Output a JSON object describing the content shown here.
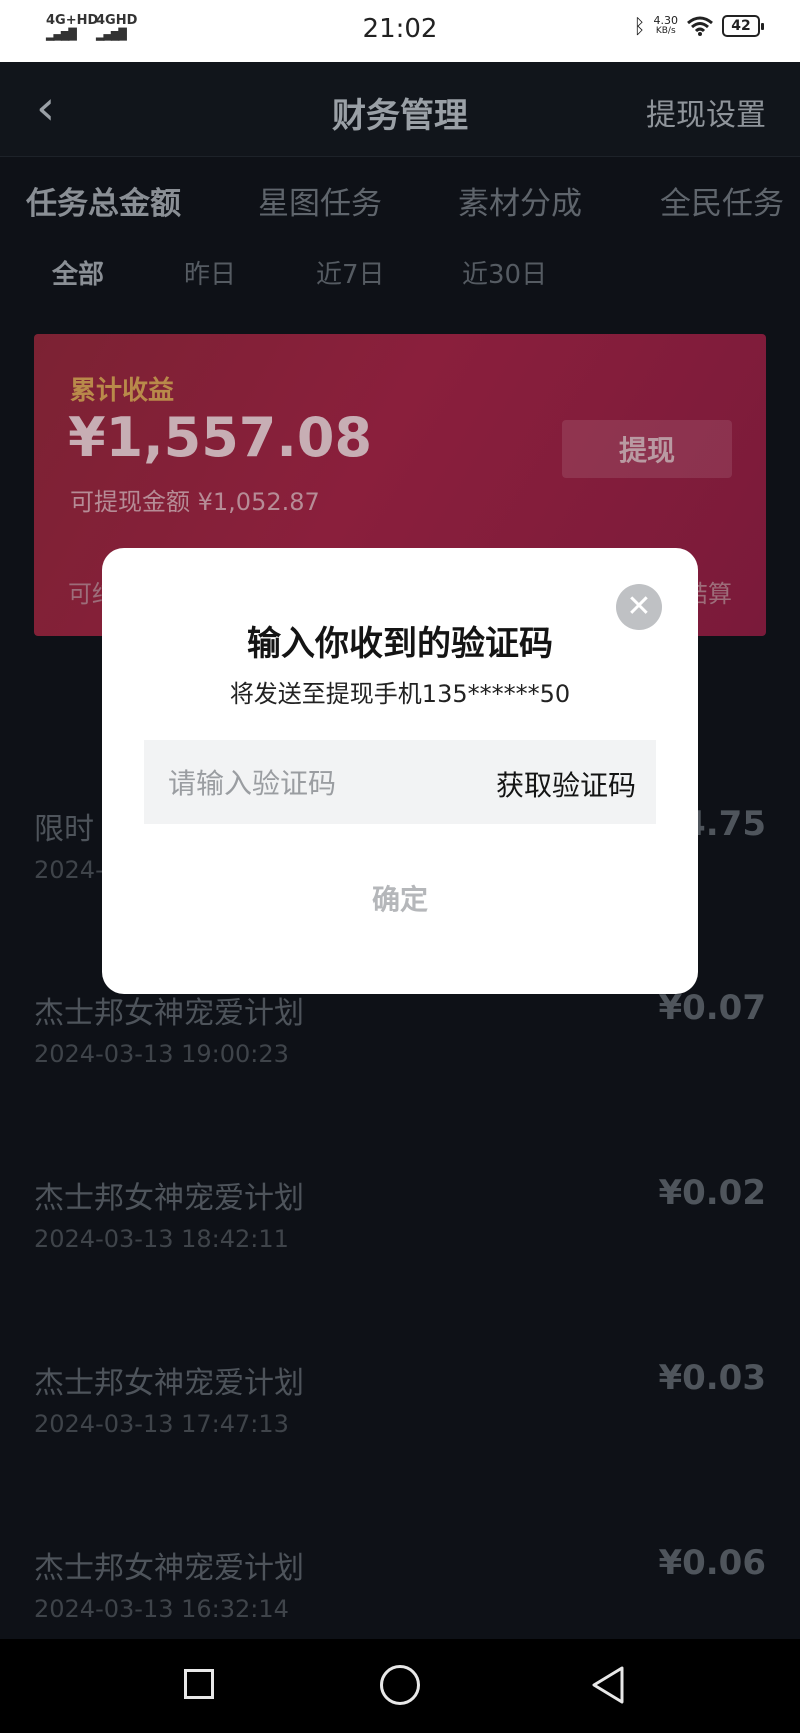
{
  "status_bar": {
    "signal1": "4G+HD",
    "signal2": "4GHD",
    "time": "21:02",
    "speed_value": "4.30",
    "speed_unit": "KB/s",
    "battery": "42",
    "icons": [
      "bluetooth-icon",
      "wifi-icon",
      "battery-icon"
    ]
  },
  "header": {
    "back_icon": "chevron-left-icon",
    "title": "财务管理",
    "right_action": "提现设置"
  },
  "tabs": [
    {
      "label": "任务总金额",
      "active": true
    },
    {
      "label": "星图任务",
      "active": false
    },
    {
      "label": "素材分成",
      "active": false
    },
    {
      "label": "全民任务",
      "active": false
    }
  ],
  "subtabs": [
    {
      "label": "全部",
      "active": true
    },
    {
      "label": "昨日",
      "active": false
    },
    {
      "label": "近7日",
      "active": false
    },
    {
      "label": "近30日",
      "active": false
    }
  ],
  "card": {
    "label": "累计收益",
    "amount": "¥1,557.08",
    "withdrawable": "可提现金额 ¥1,052.87",
    "withdraw_button": "提现",
    "foot_left": "可结",
    "foot_right": "结算"
  },
  "list": [
    {
      "title": "限时",
      "date": "2024-",
      "amount": "4.75"
    },
    {
      "title": "杰士邦女神宠爱计划",
      "date": "2024-03-13 19:00:23",
      "amount": "¥0.07"
    },
    {
      "title": "杰士邦女神宠爱计划",
      "date": "2024-03-13 18:42:11",
      "amount": "¥0.02"
    },
    {
      "title": "杰士邦女神宠爱计划",
      "date": "2024-03-13 17:47:13",
      "amount": "¥0.03"
    },
    {
      "title": "杰士邦女神宠爱计划",
      "date": "2024-03-13 16:32:14",
      "amount": "¥0.06"
    }
  ],
  "modal": {
    "close_icon": "close-icon",
    "title": "输入你收到的验证码",
    "subtitle": "将发送至提现手机135******50",
    "input_placeholder": "请输入验证码",
    "get_code": "获取验证码",
    "confirm": "确定"
  },
  "navbar": {
    "icons": [
      "recent-apps-icon",
      "home-icon",
      "back-icon"
    ]
  }
}
